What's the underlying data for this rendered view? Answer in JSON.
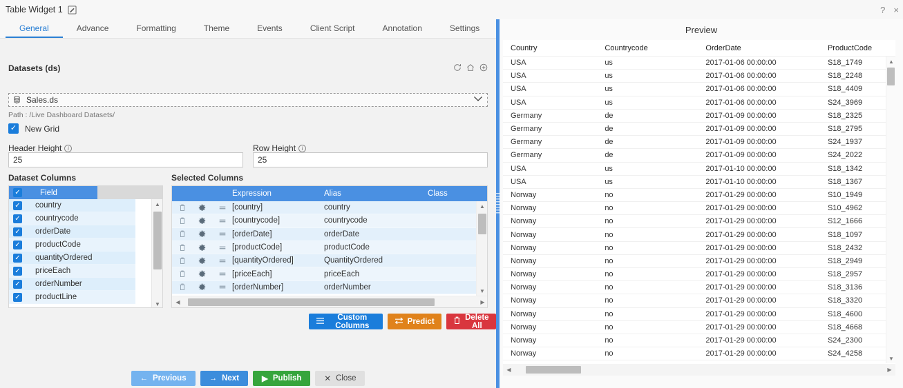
{
  "window": {
    "title": "Table Widget 1",
    "edit_icon": "pencil-edit-icon",
    "help_icon": "?",
    "close_icon": "×"
  },
  "tabs": [
    {
      "label": "General",
      "active": true
    },
    {
      "label": "Advance",
      "active": false
    },
    {
      "label": "Formatting",
      "active": false
    },
    {
      "label": "Theme",
      "active": false
    },
    {
      "label": "Events",
      "active": false
    },
    {
      "label": "Client Script",
      "active": false
    },
    {
      "label": "Annotation",
      "active": false
    },
    {
      "label": "Settings",
      "active": false
    }
  ],
  "datasets": {
    "label": "Datasets (ds)",
    "selected": "Sales.ds",
    "path": "Path : /Live Dashboard Datasets/",
    "icons": [
      "refresh-icon",
      "home-icon",
      "add-icon"
    ],
    "caret": "⌄"
  },
  "new_grid": {
    "label": "New Grid",
    "checked": true
  },
  "header_height": {
    "label": "Header Height",
    "value": "25"
  },
  "row_height": {
    "label": "Row Height",
    "value": "25"
  },
  "dataset_columns": {
    "title": "Dataset Columns",
    "header": "Field",
    "header_checked": true,
    "items": [
      {
        "label": "country",
        "checked": true
      },
      {
        "label": "countrycode",
        "checked": true
      },
      {
        "label": "orderDate",
        "checked": true
      },
      {
        "label": "productCode",
        "checked": true
      },
      {
        "label": "quantityOrdered",
        "checked": true
      },
      {
        "label": "priceEach",
        "checked": true
      },
      {
        "label": "orderNumber",
        "checked": true
      },
      {
        "label": "productLine",
        "checked": true
      }
    ]
  },
  "selected_columns": {
    "title": "Selected Columns",
    "headers": [
      "",
      "Expression",
      "Alias",
      "Class"
    ],
    "rows": [
      {
        "expression": "[country]",
        "alias": "country",
        "class": ""
      },
      {
        "expression": "[countrycode]",
        "alias": "countrycode",
        "class": ""
      },
      {
        "expression": "[orderDate]",
        "alias": "orderDate",
        "class": ""
      },
      {
        "expression": "[productCode]",
        "alias": "productCode",
        "class": ""
      },
      {
        "expression": "[quantityOrdered]",
        "alias": "QuantityOrdered",
        "class": ""
      },
      {
        "expression": "[priceEach]",
        "alias": "priceEach",
        "class": ""
      },
      {
        "expression": "[orderNumber]",
        "alias": "orderNumber",
        "class": ""
      }
    ],
    "row_icons": [
      "delete-icon",
      "settings-gear-icon",
      "drag-handle-icon"
    ]
  },
  "action_buttons": [
    {
      "label": "Custom Columns",
      "icon": "hamburger-icon",
      "color": "#1a7ddb"
    },
    {
      "label": "Predict",
      "icon": "swap-arrows-icon",
      "color": "#e0821b"
    },
    {
      "label": "Delete All",
      "icon": "trash-icon",
      "color": "#d9363e"
    }
  ],
  "footer_buttons": [
    {
      "label": "Previous",
      "icon": "←",
      "color": "#74b3ef"
    },
    {
      "label": "Next",
      "icon": "→",
      "color": "#3c8ddc"
    },
    {
      "label": "Publish",
      "icon": "▶",
      "color": "#36a53c"
    },
    {
      "label": "Close",
      "icon": "✕",
      "color": "#e0e0e0"
    }
  ],
  "preview": {
    "title": "Preview",
    "columns": [
      "Country",
      "Countrycode",
      "OrderDate",
      "ProductCode"
    ],
    "rows": [
      [
        "USA",
        "us",
        "2017-01-06 00:00:00",
        "S18_1749"
      ],
      [
        "USA",
        "us",
        "2017-01-06 00:00:00",
        "S18_2248"
      ],
      [
        "USA",
        "us",
        "2017-01-06 00:00:00",
        "S18_4409"
      ],
      [
        "USA",
        "us",
        "2017-01-06 00:00:00",
        "S24_3969"
      ],
      [
        "Germany",
        "de",
        "2017-01-09 00:00:00",
        "S18_2325"
      ],
      [
        "Germany",
        "de",
        "2017-01-09 00:00:00",
        "S18_2795"
      ],
      [
        "Germany",
        "de",
        "2017-01-09 00:00:00",
        "S24_1937"
      ],
      [
        "Germany",
        "de",
        "2017-01-09 00:00:00",
        "S24_2022"
      ],
      [
        "USA",
        "us",
        "2017-01-10 00:00:00",
        "S18_1342"
      ],
      [
        "USA",
        "us",
        "2017-01-10 00:00:00",
        "S18_1367"
      ],
      [
        "Norway",
        "no",
        "2017-01-29 00:00:00",
        "S10_1949"
      ],
      [
        "Norway",
        "no",
        "2017-01-29 00:00:00",
        "S10_4962"
      ],
      [
        "Norway",
        "no",
        "2017-01-29 00:00:00",
        "S12_1666"
      ],
      [
        "Norway",
        "no",
        "2017-01-29 00:00:00",
        "S18_1097"
      ],
      [
        "Norway",
        "no",
        "2017-01-29 00:00:00",
        "S18_2432"
      ],
      [
        "Norway",
        "no",
        "2017-01-29 00:00:00",
        "S18_2949"
      ],
      [
        "Norway",
        "no",
        "2017-01-29 00:00:00",
        "S18_2957"
      ],
      [
        "Norway",
        "no",
        "2017-01-29 00:00:00",
        "S18_3136"
      ],
      [
        "Norway",
        "no",
        "2017-01-29 00:00:00",
        "S18_3320"
      ],
      [
        "Norway",
        "no",
        "2017-01-29 00:00:00",
        "S18_4600"
      ],
      [
        "Norway",
        "no",
        "2017-01-29 00:00:00",
        "S18_4668"
      ],
      [
        "Norway",
        "no",
        "2017-01-29 00:00:00",
        "S24_2300"
      ],
      [
        "Norway",
        "no",
        "2017-01-29 00:00:00",
        "S24_4258"
      ]
    ]
  },
  "colors": {
    "accent": "#2a7fd4",
    "header_blue": "#4a90e2",
    "checkbox_blue": "#1a7ddb",
    "orange": "#e0821b",
    "red": "#d9363e",
    "green": "#36a53c"
  }
}
